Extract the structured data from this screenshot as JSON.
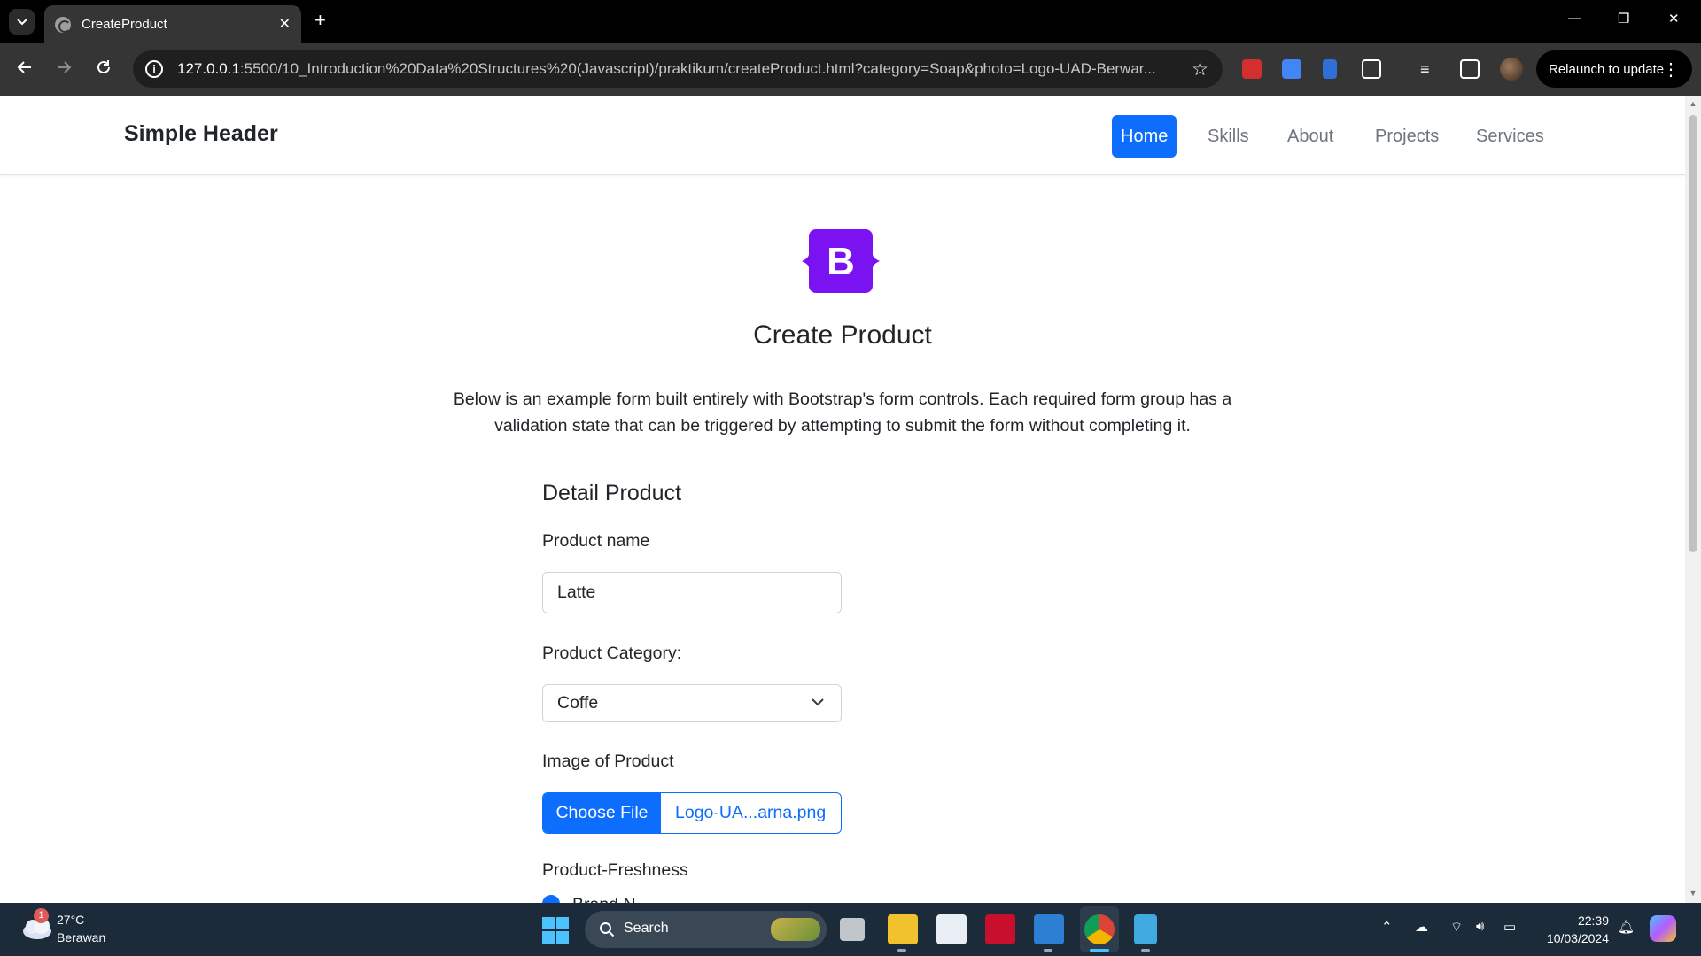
{
  "browser": {
    "tab_title": "CreateProduct",
    "url_host": "127.0.0.1",
    "url_rest": ":5500/10_Introduction%20Data%20Structures%20(Javascript)/praktikum/createProduct.html?category=Soap&photo=Logo-UAD-Berwar...",
    "relaunch_label": "Relaunch to update"
  },
  "header": {
    "brand": "Simple Header",
    "nav": [
      "Home",
      "Skills",
      "About",
      "Projects",
      "Services"
    ],
    "active_nav": "Home"
  },
  "logo_letter": "B",
  "page": {
    "title": "Create Product",
    "lead": "Below is an example form built entirely with Bootstrap's form controls. Each required form group has a validation state that can be triggered by attempting to submit the form without completing it."
  },
  "form": {
    "section_title": "Detail Product",
    "product_name_label": "Product name",
    "product_name_value": "Latte",
    "category_label": "Product Category:",
    "category_value": "Coffe",
    "image_label": "Image of Product",
    "file_button": "Choose File",
    "file_name": "Logo-UA...arna.png",
    "freshness_label": "Product-Freshness",
    "freshness_first_option": "Brand N..."
  },
  "taskbar": {
    "weather_badge": "1",
    "temperature": "27°C",
    "condition": "Berawan",
    "search_label": "Search",
    "time": "22:39",
    "date": "10/03/2024"
  },
  "colors": {
    "primary": "#0d6efd",
    "bootstrap_purple": "#7952b3",
    "chrome_dark": "#353535",
    "taskbar": "#1c2b3a"
  }
}
